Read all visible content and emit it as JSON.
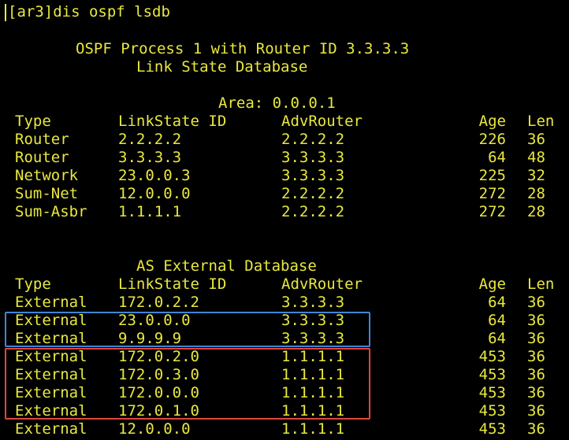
{
  "prompt": {
    "command_line": "[ar3]dis ospf lsdb"
  },
  "header": {
    "process_line": "OSPF Process 1 with Router ID 3.3.3.3",
    "db_title": "Link State Database",
    "area_line": "Area: 0.0.0.1"
  },
  "columns": {
    "type": "Type",
    "lsid": "LinkState ID",
    "adv": "AdvRouter",
    "age": "Age",
    "len": "Len"
  },
  "area_rows": [
    {
      "type": "Router",
      "lsid": "2.2.2.2",
      "adv": "2.2.2.2",
      "age": "226",
      "len": "36"
    },
    {
      "type": "Router",
      "lsid": "3.3.3.3",
      "adv": "3.3.3.3",
      "age": "64",
      "len": "48"
    },
    {
      "type": "Network",
      "lsid": "23.0.0.3",
      "adv": "3.3.3.3",
      "age": "225",
      "len": "32"
    },
    {
      "type": "Sum-Net",
      "lsid": "12.0.0.0",
      "adv": "2.2.2.2",
      "age": "272",
      "len": "28"
    },
    {
      "type": "Sum-Asbr",
      "lsid": "1.1.1.1",
      "adv": "2.2.2.2",
      "age": "272",
      "len": "28"
    }
  ],
  "external": {
    "title": "AS External Database",
    "rows": [
      {
        "type": "External",
        "lsid": "172.0.2.2",
        "adv": "3.3.3.3",
        "age": "64",
        "len": "36"
      },
      {
        "type": "External",
        "lsid": "23.0.0.0",
        "adv": "3.3.3.3",
        "age": "64",
        "len": "36"
      },
      {
        "type": "External",
        "lsid": "9.9.9.9",
        "adv": "3.3.3.3",
        "age": "64",
        "len": "36"
      },
      {
        "type": "External",
        "lsid": "172.0.2.0",
        "adv": "1.1.1.1",
        "age": "453",
        "len": "36"
      },
      {
        "type": "External",
        "lsid": "172.0.3.0",
        "adv": "1.1.1.1",
        "age": "453",
        "len": "36"
      },
      {
        "type": "External",
        "lsid": "172.0.0.0",
        "adv": "1.1.1.1",
        "age": "453",
        "len": "36"
      },
      {
        "type": "External",
        "lsid": "172.0.1.0",
        "adv": "1.1.1.1",
        "age": "453",
        "len": "36"
      },
      {
        "type": "External",
        "lsid": "12.0.0.0",
        "adv": "1.1.1.1",
        "age": "453",
        "len": "36"
      }
    ]
  },
  "colors": {
    "text": "#e8e840",
    "background": "#000000",
    "highlight_blue": "#3f86d8",
    "highlight_red": "#e0463e"
  }
}
